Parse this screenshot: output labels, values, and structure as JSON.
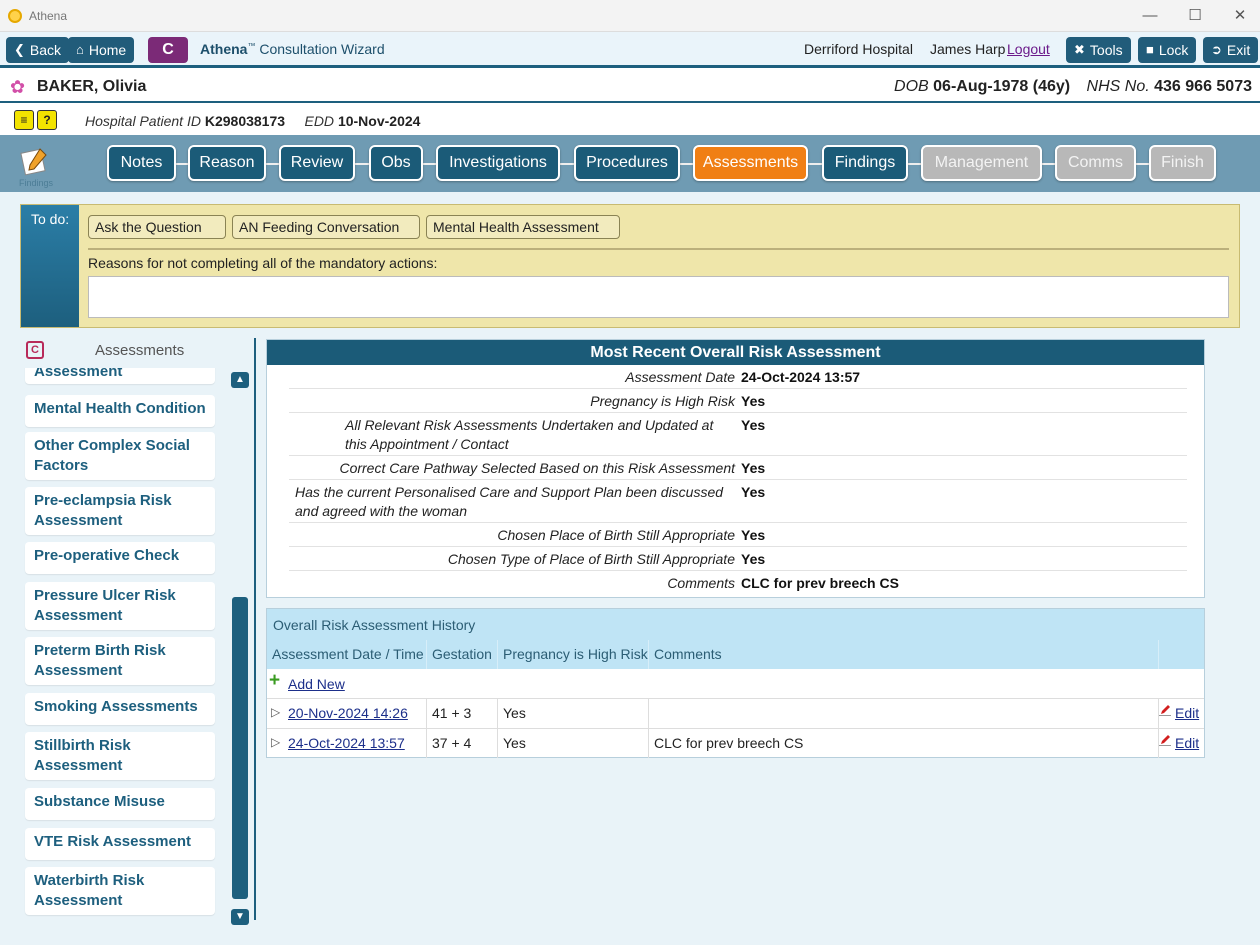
{
  "window": {
    "title": "Athena",
    "controls": {
      "minimize": "—",
      "maximize": "☐",
      "close": "✕"
    }
  },
  "topnav": {
    "back": "Back",
    "home": "Home",
    "c_button": "C",
    "brand": "Athena",
    "tm": "™",
    "wizard": "Consultation Wizard",
    "hospital": "Derriford Hospital",
    "user": "James Harp",
    "logout": "Logout",
    "tools": "Tools",
    "lock": "Lock",
    "exit": "Exit"
  },
  "patient": {
    "surname": "BAKER,",
    "forename": "Olivia",
    "dob_label": "DOB",
    "dob": "06-Aug-1978 (46y)",
    "nhs_label": "NHS No.",
    "nhs": "436 966 5073",
    "hospital_id_label": "Hospital Patient ID",
    "hospital_id": "K298038173",
    "edd_label": "EDD",
    "edd": "10-Nov-2024"
  },
  "steps": {
    "icon_label": "Findings",
    "items": [
      {
        "label": "Notes",
        "state": "normal"
      },
      {
        "label": "Reason",
        "state": "normal"
      },
      {
        "label": "Review",
        "state": "normal"
      },
      {
        "label": "Obs",
        "state": "normal"
      },
      {
        "label": "Investigations",
        "state": "normal"
      },
      {
        "label": "Procedures",
        "state": "normal"
      },
      {
        "label": "Assessments",
        "state": "active"
      },
      {
        "label": "Findings",
        "state": "normal"
      },
      {
        "label": "Management",
        "state": "disabled"
      },
      {
        "label": "Comms",
        "state": "disabled"
      },
      {
        "label": "Finish",
        "state": "disabled"
      }
    ]
  },
  "todo": {
    "label": "To do:",
    "actions": [
      "Ask the Question",
      "AN Feeding Conversation",
      "Mental Health Assessment"
    ],
    "reason_label": "Reasons for not completing all of the mandatory actions:",
    "reason_value": ""
  },
  "sidebar": {
    "title": "Assessments",
    "items": [
      "Assessment",
      "Mental Health Condition",
      "Other Complex Social Factors",
      "Pre-eclampsia Risk Assessment",
      "Pre-operative Check",
      "Pressure Ulcer Risk Assessment",
      "Preterm Birth Risk Assessment",
      "Smoking Assessments",
      "Stillbirth Risk Assessment",
      "Substance Misuse",
      "VTE Risk Assessment",
      "Waterbirth Risk Assessment"
    ]
  },
  "recent": {
    "title": "Most Recent Overall Risk Assessment",
    "rows": [
      {
        "label": "Assessment Date",
        "value": "24-Oct-2024 13:57"
      },
      {
        "label": "Pregnancy is High Risk",
        "value": "Yes"
      },
      {
        "label": "All Relevant Risk Assessments Undertaken and Updated at this Appointment / Contact",
        "value": "Yes"
      },
      {
        "label": "Correct Care Pathway Selected Based on this Risk Assessment",
        "value": "Yes"
      },
      {
        "label": "Has the current Personalised Care and Support Plan been discussed and agreed with the woman",
        "value": "Yes"
      },
      {
        "label": "Chosen Place of Birth Still Appropriate",
        "value": "Yes"
      },
      {
        "label": "Chosen Type of Place of Birth Still Appropriate",
        "value": "Yes"
      },
      {
        "label": "Comments",
        "value": "CLC for prev breech CS"
      }
    ]
  },
  "history": {
    "title": "Overall Risk Assessment History",
    "columns": [
      "Assessment Date / Time",
      "Gestation",
      "Pregnancy is High Risk",
      "Comments"
    ],
    "add_new": "Add New",
    "edit_label": "Edit",
    "rows": [
      {
        "date": "20-Nov-2024 14:26",
        "gestation": "41 + 3",
        "high_risk": "Yes",
        "comments": ""
      },
      {
        "date": "24-Oct-2024 13:57",
        "gestation": "37 + 4",
        "high_risk": "Yes",
        "comments": "CLC for prev breech CS"
      }
    ]
  },
  "colors": {
    "primary": "#1b5b78",
    "active_step": "#f07f14",
    "disabled_step": "#b8b8b8",
    "todo_bg": "#efe6aa",
    "c_button": "#7b2a77"
  }
}
